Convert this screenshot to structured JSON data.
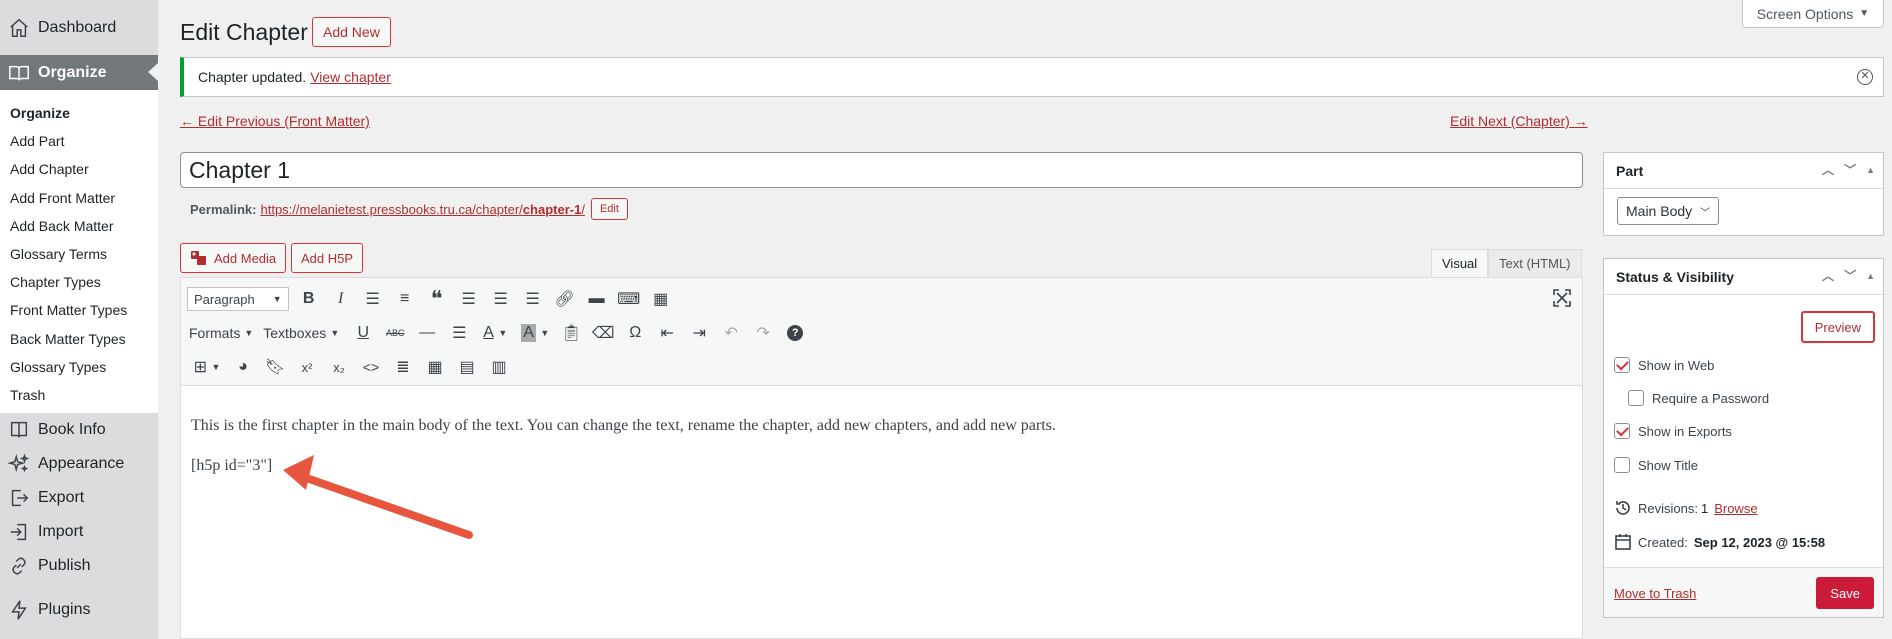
{
  "sidebar": {
    "dashboard": "Dashboard",
    "organize": "Organize",
    "submenu": [
      "Organize",
      "Add Part",
      "Add Chapter",
      "Add Front Matter",
      "Add Back Matter",
      "Glossary Terms",
      "Chapter Types",
      "Front Matter Types",
      "Back Matter Types",
      "Glossary Types",
      "Trash"
    ],
    "items": [
      "Book Info",
      "Appearance",
      "Export",
      "Import",
      "Publish",
      "Plugins"
    ]
  },
  "header": {
    "screen_options": "Screen Options",
    "title": "Edit Chapter",
    "add_new": "Add New"
  },
  "notice": {
    "text": "Chapter updated.",
    "link": "View chapter"
  },
  "nav": {
    "prev": "← Edit Previous (Front Matter)",
    "next": "Edit Next (Chapter) →"
  },
  "post": {
    "title": "Chapter 1",
    "permalink_label": "Permalink:",
    "permalink_base": "https://melanietest.pressbooks.tru.ca/chapter/",
    "permalink_slug": "chapter-1",
    "permalink_end": "/",
    "permalink_edit": "Edit"
  },
  "editor": {
    "add_media": "Add Media",
    "add_h5p": "Add H5P",
    "tab_visual": "Visual",
    "tab_text": "Text (HTML)",
    "format_select": "Paragraph",
    "formats_menu": "Formats",
    "textboxes_menu": "Textboxes",
    "paragraphs": [
      "This is the first chapter in the main body of the text. You can change the text, rename the chapter, add new chapters, and add new parts.",
      "[h5p id=\"3\"]"
    ]
  },
  "part_panel": {
    "title": "Part",
    "selected": "Main Body"
  },
  "status_panel": {
    "title": "Status & Visibility",
    "preview": "Preview",
    "show_in_web": "Show in Web",
    "require_password": "Require a Password",
    "show_in_exports": "Show in Exports",
    "show_title": "Show Title",
    "revisions_label": "Revisions:",
    "revisions_count": "1",
    "browse": "Browse",
    "created_label": "Created:",
    "created_value": "Sep 12, 2023 @ 15:58",
    "move_to_trash": "Move to Trash",
    "save": "Save"
  },
  "colors": {
    "accent": "#d63638",
    "notice_border": "#00a32a",
    "arrow": "#f0604d"
  }
}
